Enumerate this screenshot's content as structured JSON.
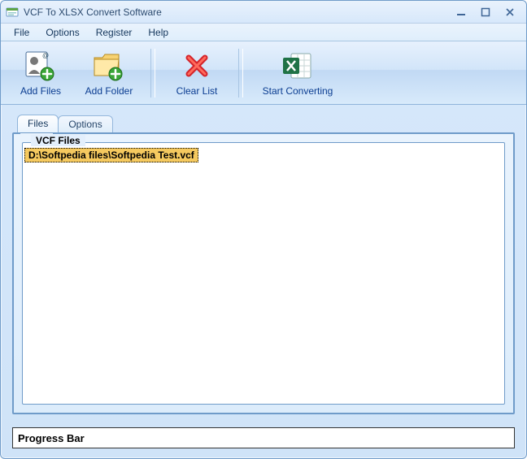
{
  "window": {
    "title": "VCF To XLSX Convert Software"
  },
  "menubar": {
    "items": [
      "File",
      "Options",
      "Register",
      "Help"
    ]
  },
  "toolbar": {
    "add_files": "Add Files",
    "add_folder": "Add Folder",
    "clear_list": "Clear List",
    "start_converting": "Start Converting"
  },
  "tabs": {
    "files": "Files",
    "options": "Options"
  },
  "list": {
    "legend": "VCF Files",
    "rows": [
      "D:\\Softpedia files\\Softpedia Test.vcf"
    ]
  },
  "footer": {
    "progress_label": "Progress Bar"
  }
}
